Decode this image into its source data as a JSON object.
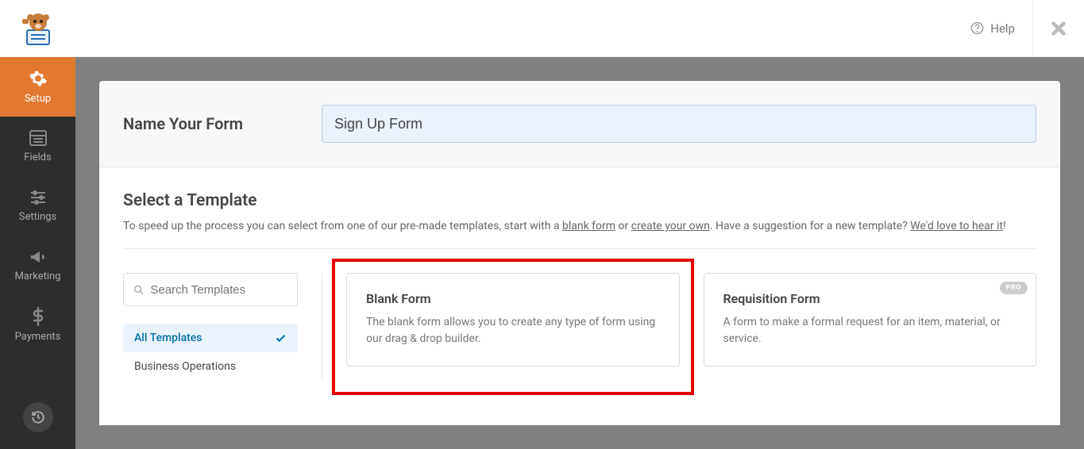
{
  "topbar": {
    "help_label": "Help"
  },
  "sidebar": {
    "items": [
      {
        "label": "Setup"
      },
      {
        "label": "Fields"
      },
      {
        "label": "Settings"
      },
      {
        "label": "Marketing"
      },
      {
        "label": "Payments"
      }
    ]
  },
  "name_section": {
    "label": "Name Your Form",
    "value": "Sign Up Form"
  },
  "template_section": {
    "title": "Select a Template",
    "desc_pre": "To speed up the process you can select from one of our pre-made templates, start with a ",
    "link_blank": "blank form",
    "desc_or": " or ",
    "link_create": "create your own",
    "desc_post": ". Have a suggestion for a new template? ",
    "link_hear": "We'd love to hear it",
    "desc_end": "!"
  },
  "search": {
    "placeholder": "Search Templates"
  },
  "categories": [
    {
      "label": "All Templates",
      "active": true
    },
    {
      "label": "Business Operations",
      "active": false
    }
  ],
  "templates": [
    {
      "title": "Blank Form",
      "desc": "The blank form allows you to create any type of form using our drag & drop builder.",
      "highlighted": true,
      "pro": false
    },
    {
      "title": "Requisition Form",
      "desc": "A form to make a formal request for an item, material, or service.",
      "highlighted": false,
      "pro": true,
      "pro_label": "PRO"
    }
  ]
}
